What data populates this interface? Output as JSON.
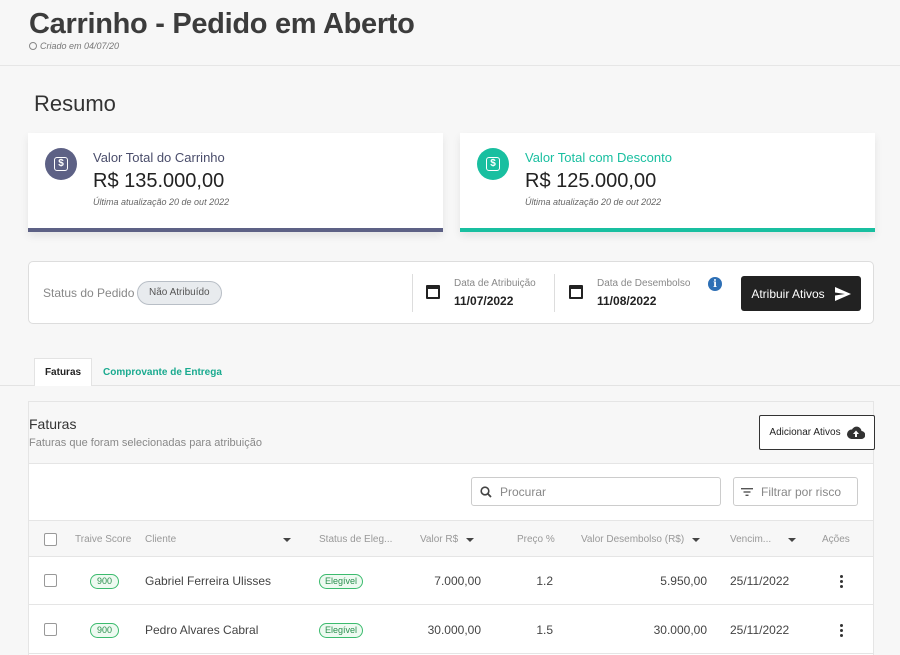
{
  "header": {
    "title": "Carrinho - Pedido em Aberto",
    "created": "Criado em 04/07/20"
  },
  "summary": {
    "title": "Resumo",
    "cards": [
      {
        "label": "Valor Total do Carrinho",
        "value": "R$ 135.000,00",
        "updated": "Última atualização 20 de out 2022",
        "color": "#5d6185"
      },
      {
        "label": "Valor Total com Desconto",
        "value": "R$ 125.000,00",
        "updated": "Última atualização 20 de out 2022",
        "color": "#19bfa0"
      }
    ]
  },
  "status": {
    "label": "Status do Pedido",
    "chip": "Não Atribuído",
    "attribution_label": "Data de Atribuição",
    "attribution_date": "11/07/2022",
    "disbursement_label": "Data de Desembolso",
    "disbursement_date": "11/08/2022",
    "action_label": "Atribuir Ativos"
  },
  "tabs": [
    {
      "label": "Faturas",
      "active": true
    },
    {
      "label": "Comprovante de Entrega",
      "active": false
    }
  ],
  "invoices": {
    "title": "Faturas",
    "subtitle": "Faturas que foram selecionadas para atribuição",
    "add_label": "Adicionar Ativos",
    "search_placeholder": "Procurar",
    "filter_label": "Filtrar por risco",
    "columns": [
      "Traive Score",
      "Cliente",
      "Status de Eleg...",
      "Valor R$",
      "Preço %",
      "Valor Desembolso (R$)",
      "Vencim...",
      "Ações"
    ],
    "rows": [
      {
        "score": "900",
        "client": "Gabriel Ferreira Ulisses",
        "status": "Elegível",
        "value": "7.000,00",
        "price": "1.2",
        "disbursement": "5.950,00",
        "due": "25/11/2022"
      },
      {
        "score": "900",
        "client": "Pedro Alvares Cabral",
        "status": "Elegível",
        "value": "30.000,00",
        "price": "1.5",
        "disbursement": "30.000,00",
        "due": "25/11/2022"
      }
    ]
  },
  "colors": {
    "accent": "#19bfa0",
    "primary_card": "#5d6185",
    "dark_button": "#222222",
    "info": "#2d6fb5",
    "eligible": "#3cbb6e"
  }
}
